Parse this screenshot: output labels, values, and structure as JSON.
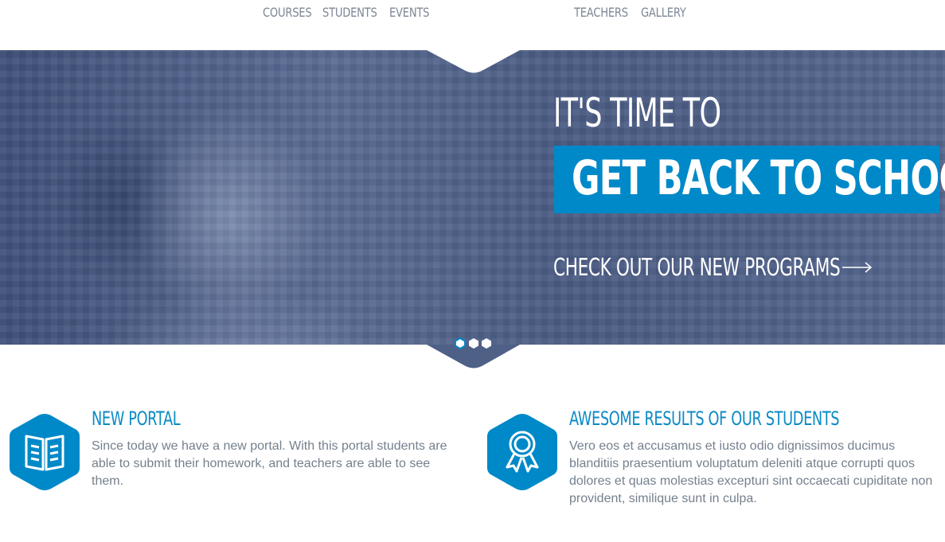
{
  "nav": {
    "items_left": [
      "COURSES",
      "STUDENTS",
      "EVENTS"
    ],
    "items_right": [
      "TEACHERS",
      "GALLERY"
    ]
  },
  "hero": {
    "pretitle": "IT'S TIME TO",
    "title": "GET BACK TO SCHOOL",
    "cta": "CHECK OUT OUR NEW PROGRAMS",
    "cta_icon": "arrow-right-icon",
    "slides_count": 3,
    "active_slide": 1,
    "accent": "#0089c8"
  },
  "features": [
    {
      "icon": "book-icon",
      "title": "NEW PORTAL",
      "text": "Since today we have a new portal. With this portal students are able to submit their homework, and teachers are able to see them."
    },
    {
      "icon": "award-ribbon-icon",
      "title": "AWESOME RESULTS OF OUR STUDENTS",
      "text": "Vero eos et accusamus et iusto odio dignissimos ducimus blanditiis praesentium voluptatum deleniti atque corrupti quos dolores et quas molestias excepturi sint occaecati cupiditate non provident, similique sunt in culpa."
    }
  ],
  "colors": {
    "brand": "#0089c8",
    "nav_text": "#7c8796",
    "body_text": "#75808d"
  }
}
